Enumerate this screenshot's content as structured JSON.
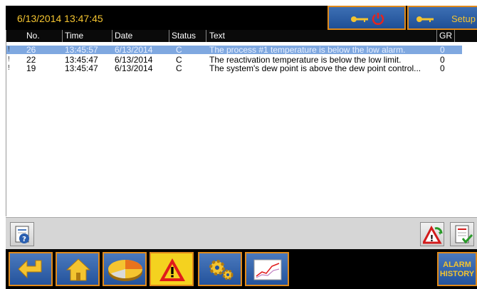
{
  "header": {
    "datetime": "6/13/2014 13:47:45",
    "setup_label": "Setup"
  },
  "table": {
    "columns": [
      "No.",
      "Time",
      "Date",
      "Status",
      "Text",
      "GR"
    ],
    "rows": [
      {
        "flag": "!",
        "no": "26",
        "time": "13:45:57",
        "date": "6/13/2014",
        "status": "C",
        "text": "The  process #1  temperature is below the low alarm.",
        "gr": "0",
        "selected": true
      },
      {
        "flag": "!",
        "no": "22",
        "time": "13:45:47",
        "date": "6/13/2014",
        "status": "C",
        "text": "The reactivation temperature is below the low limit.",
        "gr": "0",
        "selected": false
      },
      {
        "flag": "!",
        "no": "19",
        "time": "13:45:47",
        "date": "6/13/2014",
        "status": "C",
        "text": "The system's dew point is above the dew point control...",
        "gr": "0",
        "selected": false
      }
    ]
  },
  "nav": {
    "alarm_history_line1": "ALARM",
    "alarm_history_line2": "HISTORY"
  },
  "colors": {
    "accent": "#e08a1b",
    "header_text": "#f4c430",
    "selected_row": "#7fa8e0"
  }
}
